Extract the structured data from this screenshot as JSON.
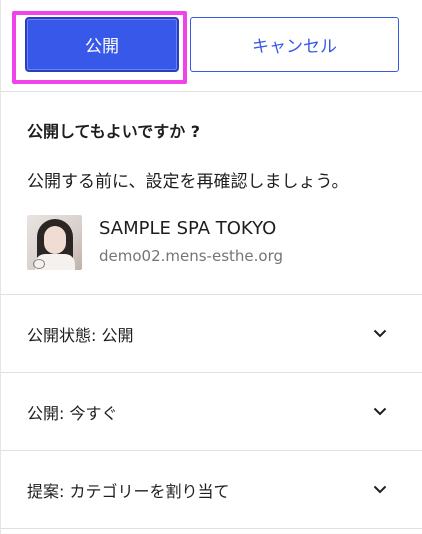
{
  "buttons": {
    "publish_label": "公開",
    "cancel_label": "キャンセル"
  },
  "confirm": {
    "heading": "公開してもよいですか ?",
    "description": "公開する前に、設定を再確認しましょう。"
  },
  "site": {
    "name": "SAMPLE SPA TOKYO",
    "url": "demo02.mens-esthe.org",
    "icon": "site-thumbnail-photo"
  },
  "settings_rows": [
    {
      "label": "公開状態: 公開",
      "icon": "chevron-down-icon"
    },
    {
      "label": "公開: 今すぐ",
      "icon": "chevron-down-icon"
    },
    {
      "label": "提案: カテゴリーを割り当て",
      "icon": "chevron-down-icon"
    }
  ],
  "colors": {
    "accent": "#3858e9",
    "highlight": "#f044ea"
  }
}
